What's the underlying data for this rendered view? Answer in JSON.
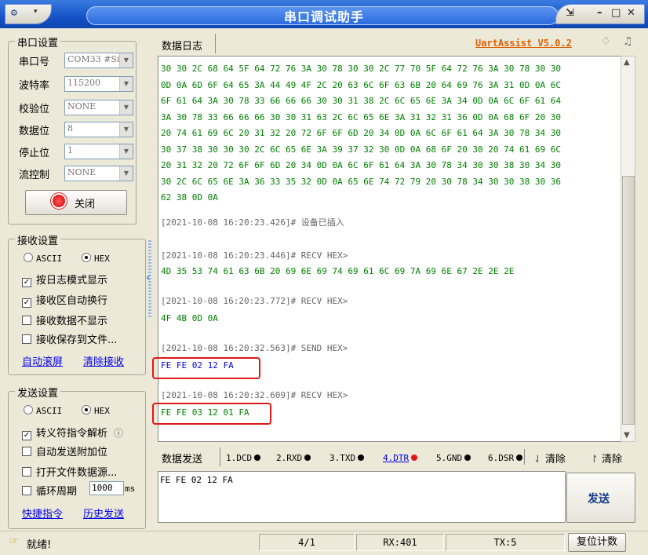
{
  "window": {
    "title": "串口调试助手",
    "menu_icon": "▾"
  },
  "serial_settings": {
    "title": "串口设置",
    "fields": [
      {
        "label": "串口号",
        "value": "COM33 #Si"
      },
      {
        "label": "波特率",
        "value": "115200"
      },
      {
        "label": "校验位",
        "value": "NONE"
      },
      {
        "label": "数据位",
        "value": "8"
      },
      {
        "label": "停止位",
        "value": "1"
      },
      {
        "label": "流控制",
        "value": "NONE"
      }
    ],
    "close_button": "关闭"
  },
  "receive_settings": {
    "title": "接收设置",
    "ascii": "ASCII",
    "hex": "HEX",
    "options": [
      "按日志模式显示",
      "接收区自动换行",
      "接收数据不显示",
      "接收保存到文件..."
    ],
    "links": [
      "自动滚屏",
      "清除接收"
    ]
  },
  "send_settings": {
    "title": "发送设置",
    "ascii": "ASCII",
    "hex": "HEX",
    "options": [
      "转义符指令解析",
      "自动发送附加位",
      "打开文件数据源...",
      "循环周期"
    ],
    "period_value": "1000",
    "period_unit": "ms",
    "links": [
      "快捷指令",
      "历史发送"
    ]
  },
  "log": {
    "tab_label": "数据日志",
    "brand": "UartAssist V5.0.2",
    "hex_lines": [
      "30 30 2C 68 64 5F 64 72 76 3A 30 78 30 30 2C 77 70 5F 64 72 76 3A 30 78 30 30",
      "0D 0A 6D 6F 64 65 3A 44 49 4F 2C 20 63 6C 6F 63 6B 20 64 69 76 3A 31 0D 0A 6C",
      "6F 61 64 3A 30 78 33 66 66 66 30 30 31 38 2C 6C 65 6E 3A 34 0D 0A 6C 6F 61 64",
      "3A 30 78 33 66 66 66 30 30 31 63 2C 6C 65 6E 3A 31 32 31 36 0D 0A 68 6F 20 30",
      "20 74 61 69 6C 20 31 32 20 72 6F 6F 6D 20 34 0D 0A 6C 6F 61 64 3A 30 78 34 30",
      "30 37 38 30 30 30 2C 6C 65 6E 3A 39 37 32 30 0D 0A 68 6F 20 30 20 74 61 69 6C",
      "20 31 32 20 72 6F 6F 6D 20 34 0D 0A 6C 6F 61 64 3A 30 78 34 30 30 38 30 34 30",
      "30 2C 6C 65 6E 3A 36 33 35 32 0D 0A 65 6E 74 72 79 20 30 78 34 30 30 38 30 36",
      "62 38 0D 0A"
    ],
    "entries": [
      {
        "header": "[2021-10-08 16:20:23.426]# 设备已插入",
        "data": ""
      },
      {
        "header": "[2021-10-08 16:20:23.446]# RECV HEX>",
        "data": "4D 35 53 74 61 63 6B 20 69 6E 69 74 69 61 6C 69 7A 69 6E 67 2E 2E 2E"
      },
      {
        "header": "[2021-10-08 16:20:23.772]# RECV HEX>",
        "data": "4F 4B 0D 0A"
      },
      {
        "header": "[2021-10-08 16:20:32.563]# SEND HEX>",
        "data": "FE FE 02 12 FA"
      },
      {
        "header": "[2021-10-08 16:20:32.609]# RECV HEX>",
        "data": "FE FE 03 12 01 FA"
      }
    ]
  },
  "send_panel": {
    "tab_label": "数据发送",
    "signals": [
      {
        "label": "1.DCD",
        "color": "#000000"
      },
      {
        "label": "2.RXD",
        "color": "#000000"
      },
      {
        "label": "3.TXD",
        "color": "#000000"
      },
      {
        "label": "4.DTR",
        "color": "#e01818"
      },
      {
        "label": "5.GND",
        "color": "#000000"
      },
      {
        "label": "6.DSR",
        "color": "#000000"
      }
    ],
    "clear1": "清除",
    "clear2": "清除",
    "input_value": "FE FE 02 12 FA",
    "send_button": "发送"
  },
  "status": {
    "ready": "就绪!",
    "page": "4/1",
    "rx": "RX:401",
    "tx": "TX:5",
    "reset": "复位计数"
  }
}
